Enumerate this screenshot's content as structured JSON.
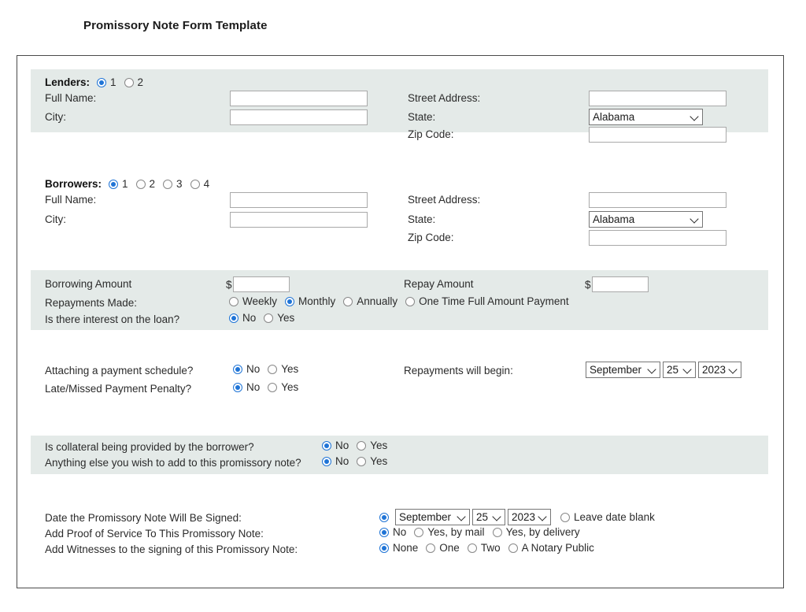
{
  "page": {
    "title": "Promissory Note Form Template"
  },
  "lenders": {
    "legend": "Lenders:",
    "count_options": [
      "1",
      "2"
    ],
    "count_selected": "1",
    "fields": {
      "full_name_label": "Full Name:",
      "full_name_value": "",
      "city_label": "City:",
      "city_value": "",
      "street_label": "Street Address:",
      "street_value": "",
      "state_label": "State:",
      "state_value": "Alabama",
      "zip_label": "Zip Code:",
      "zip_value": ""
    }
  },
  "borrowers": {
    "legend": "Borrowers:",
    "count_options": [
      "1",
      "2",
      "3",
      "4"
    ],
    "count_selected": "1",
    "fields": {
      "full_name_label": "Full Name:",
      "full_name_value": "",
      "city_label": "City:",
      "city_value": "",
      "street_label": "Street Address:",
      "street_value": "",
      "state_label": "State:",
      "state_value": "Alabama",
      "zip_label": "Zip Code:",
      "zip_value": ""
    }
  },
  "loan": {
    "borrowing_amount_label": "Borrowing Amount",
    "borrowing_amount_currency": "$",
    "borrowing_amount_value": "",
    "repay_amount_label": "Repay Amount",
    "repay_amount_currency": "$",
    "repay_amount_value": "",
    "repayments_made_label": "Repayments Made:",
    "repayments_made_options": [
      "Weekly",
      "Monthly",
      "Annually",
      "One Time Full Amount Payment"
    ],
    "repayments_made_selected": "Monthly",
    "interest_label": "Is there interest on the loan?",
    "interest_options": [
      "No",
      "Yes"
    ],
    "interest_selected": "No"
  },
  "schedule": {
    "attaching_label": "Attaching a payment schedule?",
    "attaching_options": [
      "No",
      "Yes"
    ],
    "attaching_selected": "No",
    "penalty_label": "Late/Missed Payment Penalty?",
    "penalty_options": [
      "No",
      "Yes"
    ],
    "penalty_selected": "No",
    "begin_label": "Repayments will begin:",
    "begin_month": "September",
    "begin_day": "25",
    "begin_year": "2023"
  },
  "extras": {
    "collateral_label": "Is collateral being provided by the borrower?",
    "collateral_options": [
      "No",
      "Yes"
    ],
    "collateral_selected": "No",
    "anything_else_label": "Anything else you wish to add to this promissory note?",
    "anything_else_options": [
      "No",
      "Yes"
    ],
    "anything_else_selected": "No"
  },
  "signing": {
    "date_label": "Date the Promissory Note Will Be Signed:",
    "date_month": "September",
    "date_day": "25",
    "date_year": "2023",
    "leave_blank_label": "Leave date blank",
    "proof_label": "Add Proof of Service To This Promissory Note:",
    "proof_options": [
      "No",
      "Yes, by mail",
      "Yes, by delivery"
    ],
    "proof_selected": "No",
    "witness_label": "Add Witnesses to the signing of this Promissory Note:",
    "witness_options": [
      "None",
      "One",
      "Two",
      "A Notary Public"
    ],
    "witness_selected": "None"
  },
  "colors": {
    "band_background": "#e4eae8",
    "accent_radio": "#1f74d6",
    "frame_border": "#4a4a4a"
  }
}
